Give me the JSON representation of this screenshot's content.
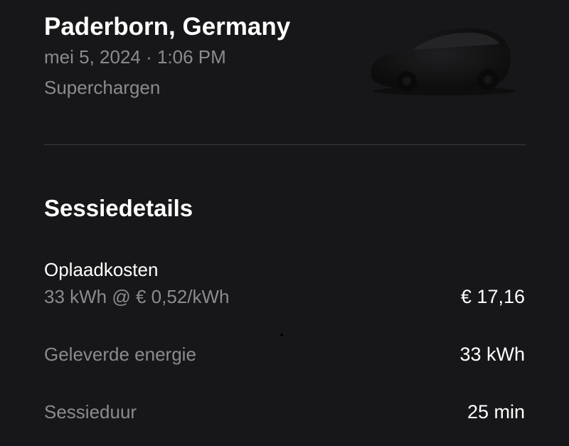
{
  "header": {
    "location": "Paderborn, Germany",
    "datetime": "mei 5, 2024 · 1:06 PM",
    "type": "Superchargen",
    "vehicle_icon": "car-silhouette"
  },
  "session": {
    "title": "Sessiedetails",
    "cost": {
      "label": "Oplaadkosten",
      "detail": "33 kWh @ € 0,52/kWh",
      "value": "€ 17,16"
    },
    "rows": [
      {
        "label": "Geleverde energie",
        "value": "33 kWh"
      },
      {
        "label": "Sessieduur",
        "value": "25 min"
      }
    ]
  },
  "colors": {
    "background": "#171719",
    "primary_text": "#ffffff",
    "secondary_text": "#8b8b8e",
    "divider": "#3a3a3d"
  }
}
